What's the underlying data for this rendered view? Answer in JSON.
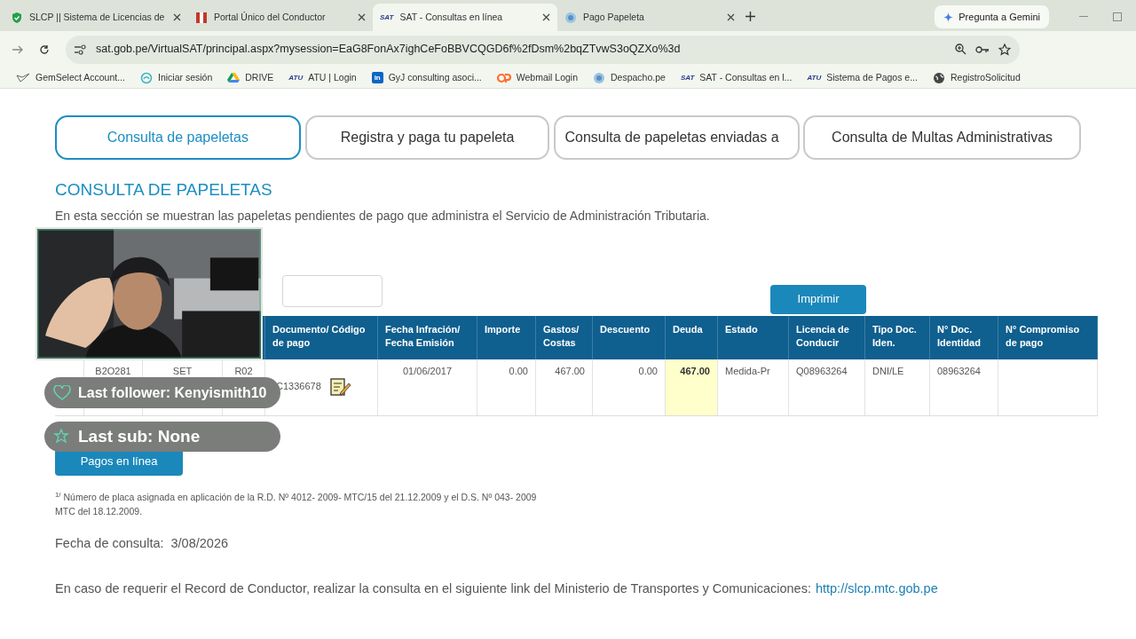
{
  "browser": {
    "tabs": [
      {
        "title": "SLCP || Sistema de Licencias de",
        "selected": false
      },
      {
        "title": "Portal Único del Conductor",
        "selected": false
      },
      {
        "title": "SAT - Consultas en línea",
        "selected": true,
        "icon_text": "SAT"
      },
      {
        "title": "Pago Papeleta",
        "selected": false
      }
    ],
    "gemini": "Pregunta a Gemini",
    "url": "sat.gob.pe/VirtualSAT/principal.aspx?mysession=EaG8FonAx7ighCeFoBBVCQGD6f%2fDsm%2bqZTvwS3oQZXo%3d",
    "bookmarks": [
      {
        "label": "GemSelect Account..."
      },
      {
        "label": "Iniciar sesión"
      },
      {
        "label": "DRIVE"
      },
      {
        "label": "ATU | Login",
        "icon_text": "ATU"
      },
      {
        "label": "GyJ consulting asoci...",
        "icon_text": "in"
      },
      {
        "label": "Webmail Login"
      },
      {
        "label": "Despacho.pe"
      },
      {
        "label": "SAT - Consultas en l...",
        "icon_text": "SAT"
      },
      {
        "label": "Sistema de Pagos e...",
        "icon_text": "ATU"
      },
      {
        "label": "RegistroSolicitud"
      }
    ]
  },
  "page": {
    "tabs": [
      {
        "label": "Consulta de papeletas",
        "selected": true
      },
      {
        "label": "Registra y paga tu papeleta",
        "selected": false
      },
      {
        "label": "Consulta de papeletas enviadas a",
        "selected": false
      },
      {
        "label": "Consulta de Multas Administrativas",
        "selected": false
      }
    ],
    "heading": "CONSULTA DE PAPELETAS",
    "description": "En esta sección se muestran las papeletas pendientes de pago que administra el Servicio de Administración Tributaria.",
    "print_button": "Imprimir",
    "table": {
      "columns": [
        "",
        "",
        "",
        "",
        "Documento/ Código de pago",
        "Fecha Infración/ Fecha Emisión",
        "Importe",
        "Gastos/ Costas",
        "Descuento",
        "Deuda",
        "Estado",
        "Licencia de Conducir",
        "Tipo Doc. Iden.",
        "N° Doc. Identidad",
        "N° Compromiso de pago"
      ],
      "rows": [
        {
          "cells": [
            {
              "text": "",
              "highlighted": false
            },
            {
              "text": "B2O281",
              "highlighted": false
            },
            {
              "text": "SET",
              "highlighted": false
            },
            {
              "text": "R02",
              "highlighted": false
            },
            {
              "text": "C1336678",
              "highlighted": false
            },
            {
              "text": "01/06/2017",
              "highlighted": false
            },
            {
              "text": "0.00",
              "highlighted": false
            },
            {
              "text": "467.00",
              "highlighted": false
            },
            {
              "text": "0.00",
              "highlighted": false
            },
            {
              "text": "467.00",
              "highlighted": true
            },
            {
              "text": "Medida-Pr",
              "highlighted": false
            },
            {
              "text": "Q08963264",
              "highlighted": false
            },
            {
              "text": "DNI/LE",
              "highlighted": false
            },
            {
              "text": "08963264",
              "highlighted": false
            },
            {
              "text": "",
              "highlighted": false
            }
          ]
        }
      ]
    },
    "pay_button": "Pagos en línea",
    "footnote": "$^{1/}$ Número de placa asignada en aplicación de la R.D. Nº 4012- 2009- MTC/15 del 21.12.2009 y el D.S. Nº 043- 2009 MTC del 18.12.2009.",
    "query_date_label": "Fecha de consulta:",
    "query_date": "3/08/2026",
    "record_text": "En caso de requerir el Record de Conductor, realizar la consulta en el siguiente link del Ministerio de Transportes y Comunicaciones:",
    "record_link": "http://slcp.mtc.gob.pe"
  },
  "overlay": {
    "last_follower": "Last follower: Kenyismith10",
    "last_sub": "Last sub: None"
  }
}
